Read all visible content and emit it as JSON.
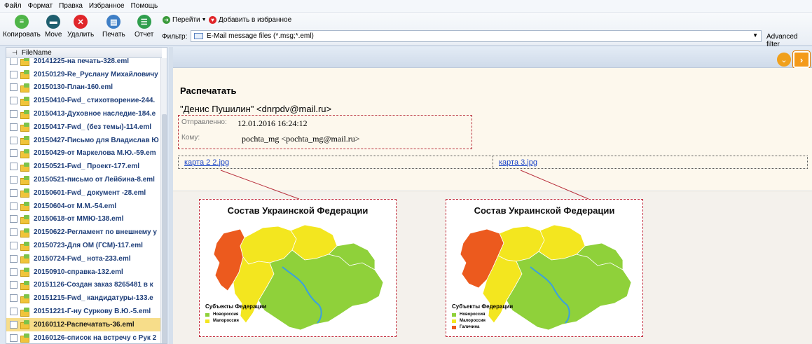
{
  "menu": [
    "Файл",
    "Формат",
    "Правка",
    "Избранное",
    "Помощь"
  ],
  "toolbar": {
    "copy": "Копировать",
    "move": "Move",
    "delete": "Удалить",
    "print": "Печать",
    "report": "Отчет",
    "goto": "Перейти",
    "favorite": "Добавить в избранное",
    "filter_label": "Фильтр:",
    "filter_value": "E-Mail message files (*.msg;*.eml)",
    "advanced_filter": "Advanced filter"
  },
  "filelist": {
    "header": "FileName",
    "items": [
      "20141225-на печать-328.eml",
      "20150129-Re_Руслану Михайловичу",
      "20150130-План-160.eml",
      "20150410-Fwd_ стихотворение-244.",
      "20150413-Духовное наследие-184.e",
      "20150417-Fwd_ (без темы)-114.eml",
      "20150427-Письмо для Владислав Ю",
      "20150429-от Маркелова М.Ю.-59.em",
      "20150521-Fwd_ Проект-177.eml",
      "20150521-письмо от Лейбина-8.eml",
      "20150601-Fwd_ документ -28.eml",
      "20150604-от М.М.-54.eml",
      "20150618-от ММЮ-138.eml",
      "20150622-Регламент по внешнему у",
      "20150723-Для ОМ (ГСМ)-117.eml",
      "20150724-Fwd_ нота-233.eml",
      "20150910-справка-132.eml",
      "20151126-Создан заказ 8265481 в к",
      "20151215-Fwd_ кандидатуры-133.e",
      "20151221-Г-ну Суркову В.Ю.-5.eml",
      "20160112-Распечатать-36.eml",
      "20160126-список на встречу с Рук 2"
    ],
    "selected_index": 20
  },
  "message": {
    "subject": "Распечатать",
    "sender": "\"Денис Пушилин\" <dnrpdv@mail.ru>",
    "sent_label": "Отправленно:",
    "sent_value": "12.01.2016 16:24:12",
    "to_label": "Кому:",
    "to_value": "pochta_mg <pochta_mg@mail.ru>",
    "attachments": [
      "карта 2 2.jpg",
      "карта 3.jpg"
    ]
  },
  "maps": [
    {
      "title": "Состав Украинской Федерации",
      "legend_title": "Субъекты Федерации",
      "legend": [
        {
          "label": "Новороссия",
          "color": "#8fd13a"
        },
        {
          "label": "Малороссия",
          "color": "#f3e61f"
        }
      ]
    },
    {
      "title": "Состав Украинской Федерации",
      "legend_title": "Субъекты Федерации",
      "legend": [
        {
          "label": "Новороссия",
          "color": "#8fd13a"
        },
        {
          "label": "Малороссия",
          "color": "#f3e61f"
        },
        {
          "label": "Галичина",
          "color": "#ec5a1e"
        }
      ]
    }
  ],
  "colors": {
    "accent": "#f49a1a",
    "link": "#1a44c8",
    "selected_row": "#f7dd8a",
    "dashed_border": "#c2283a"
  }
}
